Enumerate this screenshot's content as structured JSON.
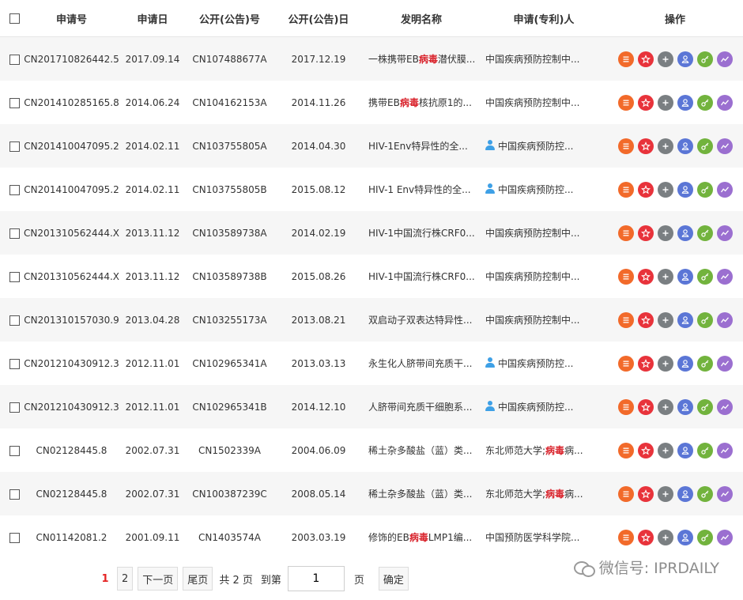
{
  "table": {
    "headers": [
      "申请号",
      "申请日",
      "公开(公告)号",
      "公开(公告)日",
      "发明名称",
      "申请(专利)人",
      "操作"
    ],
    "rows": [
      {
        "app_no": "CN201710826442.5",
        "app_date": "2017.09.14",
        "pub_no": "CN107488677A",
        "pub_date": "2017.12.19",
        "title": [
          {
            "t": "一株携带EB"
          },
          {
            "t": "病毒",
            "h": true
          },
          {
            "t": "潜伏膜..."
          }
        ],
        "applicant": [
          {
            "t": "中国疾病预防控制中..."
          }
        ],
        "person": false
      },
      {
        "app_no": "CN201410285165.8",
        "app_date": "2014.06.24",
        "pub_no": "CN104162153A",
        "pub_date": "2014.11.26",
        "title": [
          {
            "t": "携带EB"
          },
          {
            "t": "病毒",
            "h": true
          },
          {
            "t": "核抗原1的..."
          }
        ],
        "applicant": [
          {
            "t": "中国疾病预防控制中..."
          }
        ],
        "person": false
      },
      {
        "app_no": "CN201410047095.2",
        "app_date": "2014.02.11",
        "pub_no": "CN103755805A",
        "pub_date": "2014.04.30",
        "title": [
          {
            "t": "HIV-1Env特异性的全..."
          }
        ],
        "applicant": [
          {
            "t": "中国疾病预防控..."
          }
        ],
        "person": true
      },
      {
        "app_no": "CN201410047095.2",
        "app_date": "2014.02.11",
        "pub_no": "CN103755805B",
        "pub_date": "2015.08.12",
        "title": [
          {
            "t": "HIV-1 Env特异性的全..."
          }
        ],
        "applicant": [
          {
            "t": "中国疾病预防控..."
          }
        ],
        "person": true
      },
      {
        "app_no": "CN201310562444.X",
        "app_date": "2013.11.12",
        "pub_no": "CN103589738A",
        "pub_date": "2014.02.19",
        "title": [
          {
            "t": "HIV-1中国流行株CRF0..."
          }
        ],
        "applicant": [
          {
            "t": "中国疾病预防控制中..."
          }
        ],
        "person": false
      },
      {
        "app_no": "CN201310562444.X",
        "app_date": "2013.11.12",
        "pub_no": "CN103589738B",
        "pub_date": "2015.08.26",
        "title": [
          {
            "t": "HIV-1中国流行株CRF0..."
          }
        ],
        "applicant": [
          {
            "t": "中国疾病预防控制中..."
          }
        ],
        "person": false
      },
      {
        "app_no": "CN201310157030.9",
        "app_date": "2013.04.28",
        "pub_no": "CN103255173A",
        "pub_date": "2013.08.21",
        "title": [
          {
            "t": "双启动子双表达特异性..."
          }
        ],
        "applicant": [
          {
            "t": "中国疾病预防控制中..."
          }
        ],
        "person": false
      },
      {
        "app_no": "CN201210430912.3",
        "app_date": "2012.11.01",
        "pub_no": "CN102965341A",
        "pub_date": "2013.03.13",
        "title": [
          {
            "t": "永生化人脐带间充质干..."
          }
        ],
        "applicant": [
          {
            "t": "中国疾病预防控..."
          }
        ],
        "person": true
      },
      {
        "app_no": "CN201210430912.3",
        "app_date": "2012.11.01",
        "pub_no": "CN102965341B",
        "pub_date": "2014.12.10",
        "title": [
          {
            "t": "人脐带间充质干细胞系..."
          }
        ],
        "applicant": [
          {
            "t": "中国疾病预防控..."
          }
        ],
        "person": true
      },
      {
        "app_no": "CN02128445.8",
        "app_date": "2002.07.31",
        "pub_no": "CN1502339A",
        "pub_date": "2004.06.09",
        "title": [
          {
            "t": "稀土杂多酸盐（蓝）类..."
          }
        ],
        "applicant": [
          {
            "t": "东北师范大学;"
          },
          {
            "t": "病毒",
            "h": true
          },
          {
            "t": "病..."
          }
        ],
        "person": false
      },
      {
        "app_no": "CN02128445.8",
        "app_date": "2002.07.31",
        "pub_no": "CN100387239C",
        "pub_date": "2008.05.14",
        "title": [
          {
            "t": "稀土杂多酸盐（蓝）类..."
          }
        ],
        "applicant": [
          {
            "t": "东北师范大学;"
          },
          {
            "t": "病毒",
            "h": true
          },
          {
            "t": "病..."
          }
        ],
        "person": false
      },
      {
        "app_no": "CN01142081.2",
        "app_date": "2001.09.11",
        "pub_no": "CN1403574A",
        "pub_date": "2003.03.19",
        "title": [
          {
            "t": "修饰的EB"
          },
          {
            "t": "病毒",
            "h": true
          },
          {
            "t": "LMP1编..."
          }
        ],
        "applicant": [
          {
            "t": "中国预防医学科学院..."
          }
        ],
        "person": false
      }
    ]
  },
  "actions": [
    {
      "name": "list-icon",
      "color": "#f26a2a"
    },
    {
      "name": "star-icon",
      "color": "#e8333b"
    },
    {
      "name": "plus-icon",
      "color": "#7a7f82"
    },
    {
      "name": "user-icon",
      "color": "#5b76d6"
    },
    {
      "name": "key-icon",
      "color": "#72b33d"
    },
    {
      "name": "trend-icon",
      "color": "#9b6fd0"
    }
  ],
  "pager": {
    "current": "1",
    "page2": "2",
    "next": "下一页",
    "last": "尾页",
    "total": "共 2 页",
    "goto": "到第",
    "input_value": "1",
    "page_unit": "页",
    "confirm": "确定"
  },
  "watermark": "微信号: IPRDAILY",
  "colors": {
    "highlight": "#d9232c",
    "row_alt": "#f6f6f6",
    "current_page": "#e52424"
  }
}
